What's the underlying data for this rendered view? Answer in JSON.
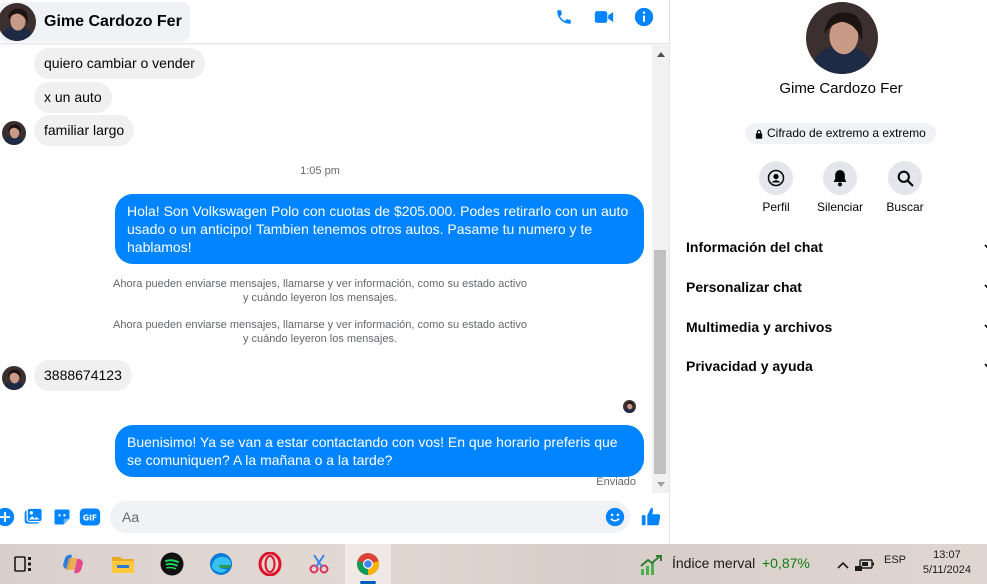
{
  "contact": {
    "name": "Gime Cardozo Fer"
  },
  "messages": {
    "in_1": "quiero cambiar o vender",
    "in_2": "x un auto",
    "in_3": "familiar largo",
    "time": "1:05 pm",
    "out_1": "Hola! Son Volkswagen Polo con cuotas de $205.000. Podes retirarlo con un auto usado o un anticipo! Tambien tenemos otros autos. Pasame tu numero y te hablamos!",
    "system_1": "Ahora pueden enviarse mensajes, llamarse y ver información, como su estado activo y cuándo leyeron los mensajes.",
    "system_2": "Ahora pueden enviarse mensajes, llamarse y ver información, como su estado activo y cuándo leyeron los mensajes.",
    "in_4": "3888674123",
    "out_2": "Buenisimo! Ya se van a estar contactando con vos! En que horario preferis que se comuniquen? A la mañana o a la tarde?",
    "status": "Enviado"
  },
  "composer": {
    "placeholder": "Aa"
  },
  "info": {
    "encryption": "Cifrado de extremo a extremo",
    "actions": [
      "Perfil",
      "Silenciar",
      "Buscar"
    ],
    "menu": [
      "Información del chat",
      "Personalizar chat",
      "Multimedia y archivos",
      "Privacidad y ayuda"
    ]
  },
  "taskbar": {
    "widget_name": "Índice merval",
    "widget_value": "+0,87%",
    "language": "ESP",
    "time": "13:07",
    "date": "5/11/2024"
  },
  "colors": {
    "messenger_blue": "#0084ff",
    "bubble_gray": "#f0f0f0",
    "positive_green": "#0f7b0f"
  },
  "icons": [
    "phone-icon",
    "video-icon",
    "info-icon",
    "plus-icon",
    "image-icon",
    "sticker-icon",
    "gif-icon",
    "emoji-icon",
    "like-icon",
    "lock-icon",
    "profile-icon",
    "bell-icon",
    "search-icon",
    "chevron-down-icon"
  ]
}
